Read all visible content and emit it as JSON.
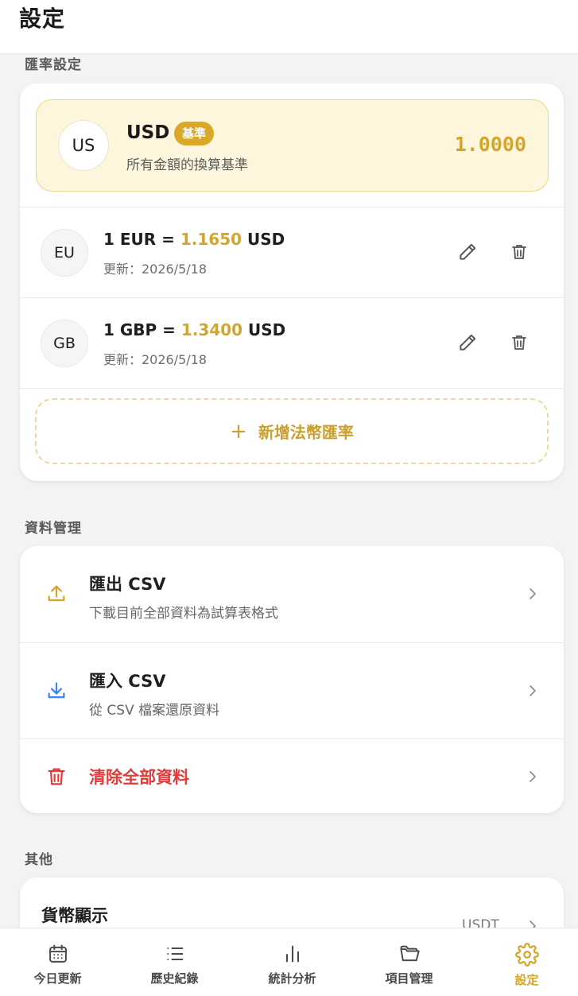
{
  "header": {
    "title": "設定"
  },
  "rates": {
    "section_title": "匯率設定",
    "base": {
      "avatar": "US",
      "code": "USD",
      "badge": "基準",
      "desc": "所有金額的換算基準",
      "rate": "1.0000"
    },
    "items": [
      {
        "avatar": "EU",
        "prefix": "1 EUR = ",
        "rate": "1.1650",
        "suffix": " USD",
        "updated": "更新：2026/5/18",
        "edit_icon": "pencil-icon",
        "delete_icon": "trash-icon"
      },
      {
        "avatar": "GB",
        "prefix": "1 GBP = ",
        "rate": "1.3400",
        "suffix": " USD",
        "updated": "更新：2026/5/18",
        "edit_icon": "pencil-icon",
        "delete_icon": "trash-icon"
      }
    ],
    "add_label": "新增法幣匯率"
  },
  "data_mgmt": {
    "section_title": "資料管理",
    "export": {
      "title": "匯出 CSV",
      "sub": "下載目前全部資料為試算表格式",
      "icon": "upload-icon"
    },
    "import": {
      "title": "匯入 CSV",
      "sub": "從 CSV 檔案還原資料",
      "icon": "download-icon"
    },
    "clear": {
      "title": "清除全部資料",
      "icon": "trash-icon"
    }
  },
  "other": {
    "section_title": "其他",
    "currency_display": {
      "title": "貨幣顯示",
      "value": "USDT"
    }
  },
  "nav": {
    "items": [
      {
        "label": "今日更新",
        "icon": "calendar-icon"
      },
      {
        "label": "歷史紀錄",
        "icon": "list-icon"
      },
      {
        "label": "統計分析",
        "icon": "bar-chart-icon"
      },
      {
        "label": "項目管理",
        "icon": "folder-icon"
      },
      {
        "label": "設定",
        "icon": "gear-icon",
        "active": true
      }
    ]
  },
  "colors": {
    "accent": "#d3a52a",
    "danger": "#e23b3b",
    "import_blue": "#3b82f6",
    "base_bg": "#fdf6dc"
  }
}
